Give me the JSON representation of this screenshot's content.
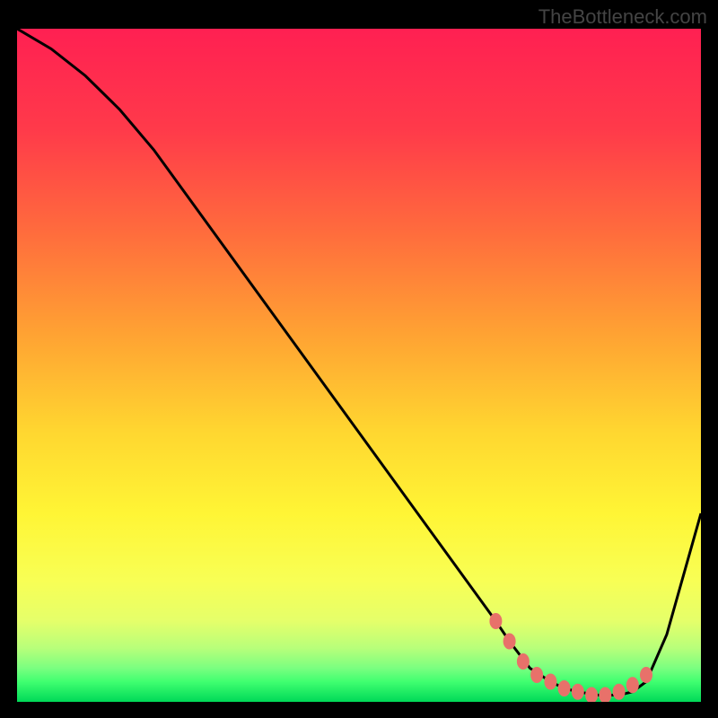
{
  "watermark": "TheBottleneck.com",
  "chart_data": {
    "type": "line",
    "title": "",
    "xlabel": "",
    "ylabel": "",
    "xlim": [
      0,
      100
    ],
    "ylim": [
      0,
      100
    ],
    "gradient_stops": [
      {
        "offset": 0,
        "color": "#ff2052"
      },
      {
        "offset": 15,
        "color": "#ff3a4a"
      },
      {
        "offset": 30,
        "color": "#ff6b3d"
      },
      {
        "offset": 45,
        "color": "#ffa133"
      },
      {
        "offset": 60,
        "color": "#ffd730"
      },
      {
        "offset": 72,
        "color": "#fff535"
      },
      {
        "offset": 82,
        "color": "#f8ff55"
      },
      {
        "offset": 88,
        "color": "#e5ff6a"
      },
      {
        "offset": 92,
        "color": "#b8ff7a"
      },
      {
        "offset": 95,
        "color": "#7aff80"
      },
      {
        "offset": 97,
        "color": "#40ff70"
      },
      {
        "offset": 100,
        "color": "#00d958"
      }
    ],
    "series": [
      {
        "name": "curve",
        "x": [
          0,
          5,
          10,
          15,
          20,
          25,
          30,
          35,
          40,
          45,
          50,
          55,
          60,
          65,
          70,
          72,
          75,
          78,
          80,
          82,
          85,
          88,
          90,
          92,
          95,
          100
        ],
        "y": [
          100,
          97,
          93,
          88,
          82,
          75,
          68,
          61,
          54,
          47,
          40,
          33,
          26,
          19,
          12,
          9,
          5,
          3,
          2,
          1.5,
          1,
          1,
          1.5,
          3,
          10,
          28
        ]
      }
    ],
    "markers": {
      "name": "dots",
      "color": "#e8716a",
      "x": [
        70,
        72,
        74,
        76,
        78,
        80,
        82,
        84,
        86,
        88,
        90,
        92
      ],
      "y": [
        12,
        9,
        6,
        4,
        3,
        2,
        1.5,
        1,
        1,
        1.5,
        2.5,
        4
      ]
    }
  }
}
